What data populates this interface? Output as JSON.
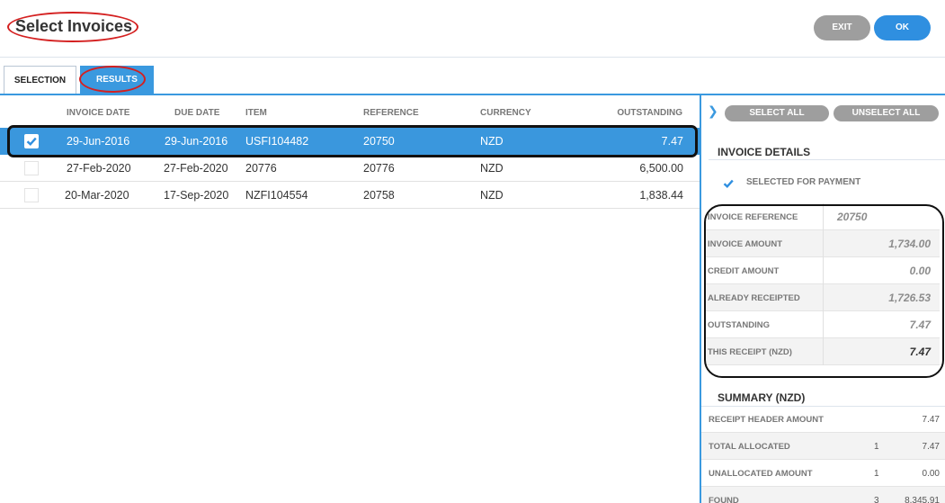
{
  "header": {
    "title": "Select Invoices",
    "exit_label": "EXIT",
    "ok_label": "OK"
  },
  "tabs": {
    "selection": "SELECTION",
    "results": "RESULTS"
  },
  "table": {
    "columns": {
      "invoice_date": "INVOICE DATE",
      "due_date": "DUE DATE",
      "item": "ITEM",
      "reference": "REFERENCE",
      "currency": "CURRENCY",
      "outstanding": "OUTSTANDING"
    },
    "rows": [
      {
        "checked": true,
        "invoice_date": "29-Jun-2016",
        "due_date": "29-Jun-2016",
        "item": "USFI104482",
        "reference": "20750",
        "currency": "NZD",
        "outstanding": "7.47"
      },
      {
        "checked": false,
        "invoice_date": "27-Feb-2020",
        "due_date": "27-Feb-2020",
        "item": "20776",
        "reference": "20776",
        "currency": "NZD",
        "outstanding": "6,500.00"
      },
      {
        "checked": false,
        "invoice_date": "20-Mar-2020",
        "due_date": "17-Sep-2020",
        "item": "NZFI104554",
        "reference": "20758",
        "currency": "NZD",
        "outstanding": "1,838.44"
      }
    ]
  },
  "side": {
    "select_all": "SELECT ALL",
    "unselect_all": "UNSELECT ALL",
    "details_title": "INVOICE DETAILS",
    "selected_for_payment": "SELECTED FOR PAYMENT",
    "details": [
      {
        "label": "INVOICE REFERENCE",
        "value": "20750"
      },
      {
        "label": "INVOICE AMOUNT",
        "value": "1,734.00"
      },
      {
        "label": "CREDIT AMOUNT",
        "value": "0.00"
      },
      {
        "label": "ALREADY RECEIPTED",
        "value": "1,726.53"
      },
      {
        "label": "OUTSTANDING",
        "value": "7.47"
      },
      {
        "label": "THIS RECEIPT (NZD)",
        "value": "7.47"
      }
    ],
    "summary_title": "SUMMARY (NZD)",
    "summary": [
      {
        "label": "RECEIPT HEADER AMOUNT",
        "count": "",
        "value": "7.47"
      },
      {
        "label": "TOTAL ALLOCATED",
        "count": "1",
        "value": "7.47"
      },
      {
        "label": "UNALLOCATED AMOUNT",
        "count": "1",
        "value": "0.00"
      },
      {
        "label": "FOUND",
        "count": "3",
        "value": "8,345.91"
      }
    ]
  },
  "colors": {
    "accent": "#3a99df",
    "button_grey": "#9e9e9e",
    "annotation_red": "#d42020"
  }
}
